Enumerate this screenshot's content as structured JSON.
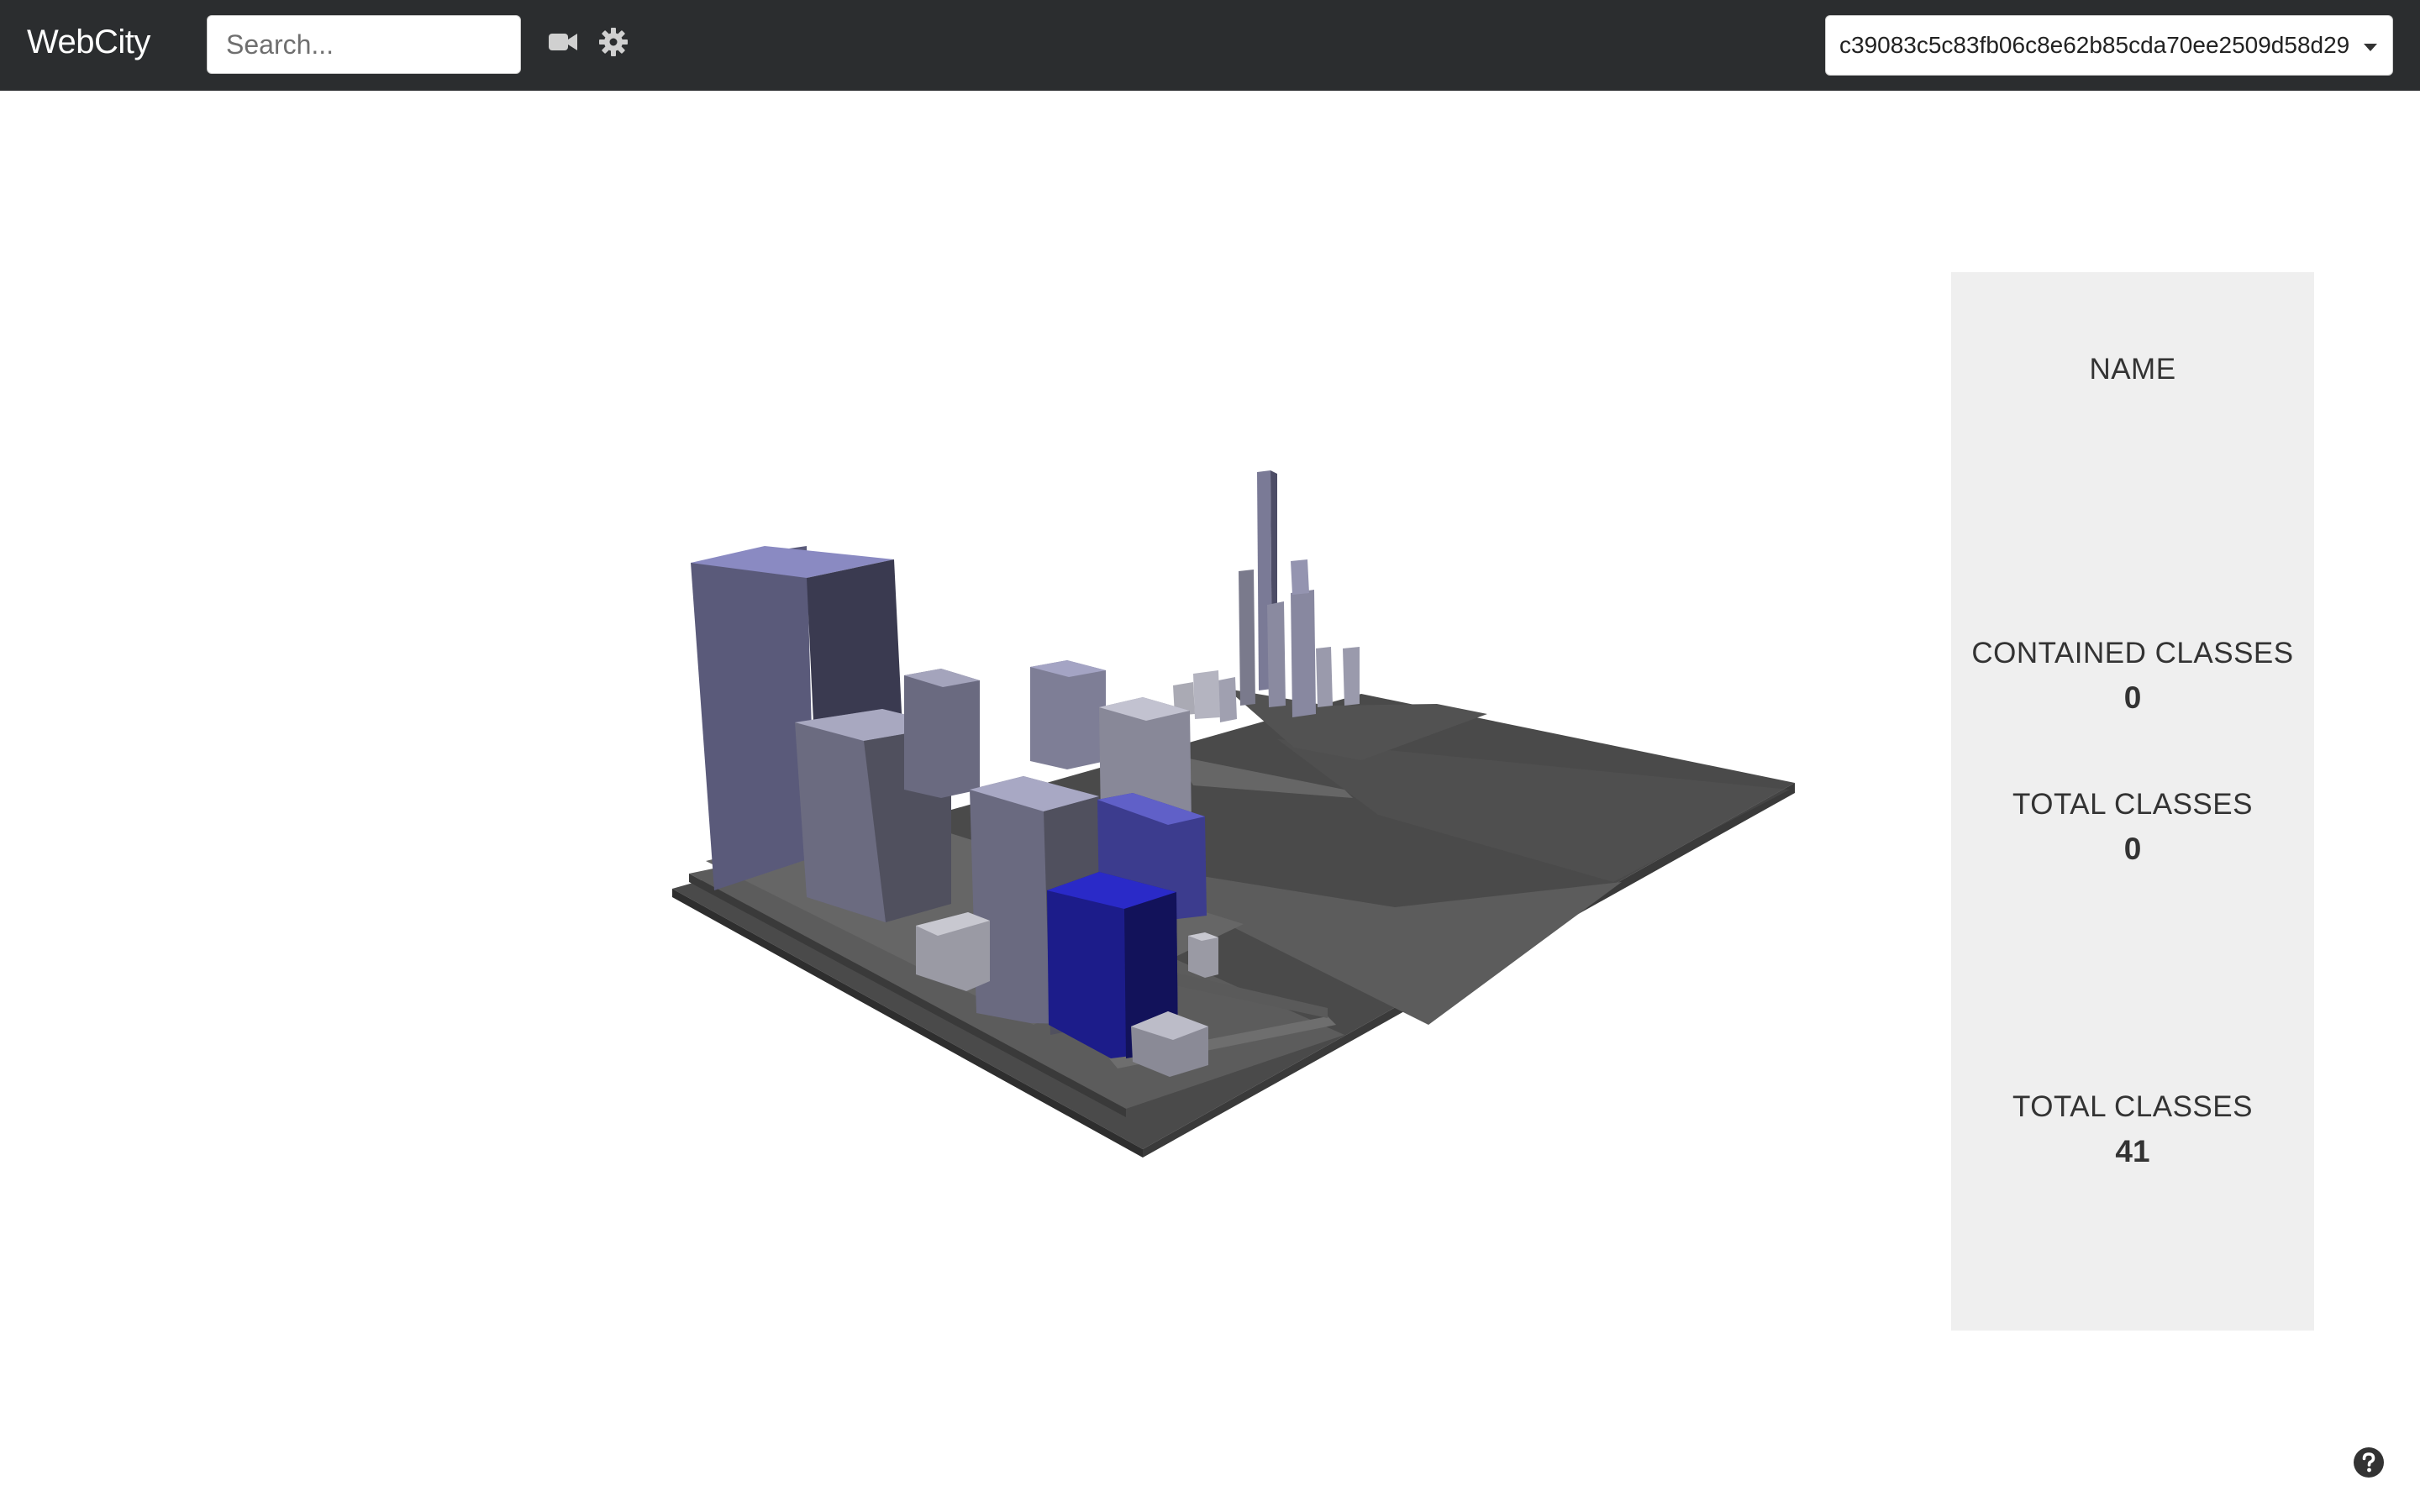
{
  "navbar": {
    "brand": "WebCity",
    "search_placeholder": "Search...",
    "camera_icon": "video-camera-icon",
    "settings_icon": "gear-icon",
    "commit": "c39083c5c83fb06c8e62b85cda70ee2509d58d29"
  },
  "panel": {
    "name_label": "NAME",
    "contained_label": "CONTAINED CLASSES",
    "contained_value": "0",
    "total_label": "TOTAL CLASSES",
    "total_value": "0",
    "overall_total_label": "TOTAL CLASSES",
    "overall_total_value": "41"
  },
  "help_icon": "question-circle-icon",
  "colors": {
    "navbar": "#2b2d2f",
    "panel": "#efefef",
    "selected_building": "#2020a8",
    "base": "#555555"
  }
}
